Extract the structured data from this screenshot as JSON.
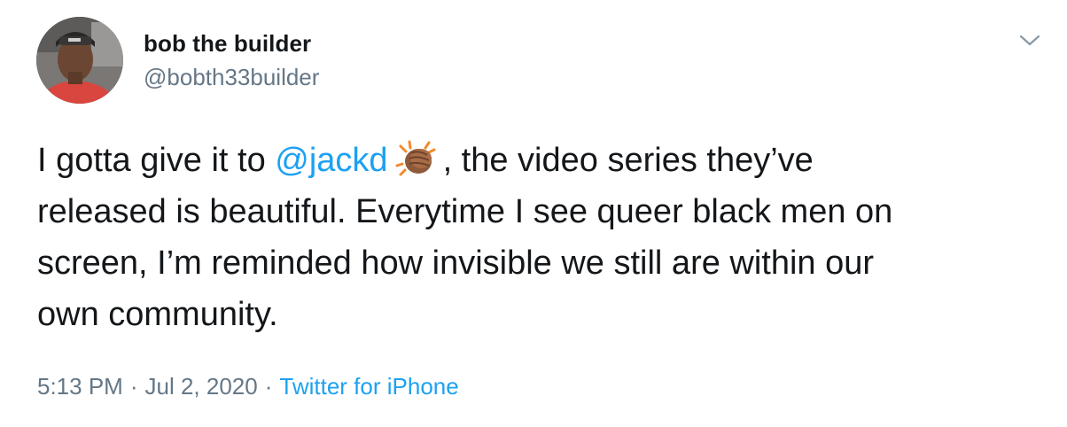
{
  "user": {
    "name": "bob the builder",
    "handle": "@bobth33builder"
  },
  "tweet": {
    "line1_before": "I gotta give it to ",
    "mention": "@jackd",
    "emoji_icon": "clapping-hands-icon",
    "line1_after": ", the video series they’ve",
    "line2": "released is beautiful. Everytime I see queer black men on",
    "line3": "screen, I’m reminded how invisible we still are within our",
    "line4": "own community."
  },
  "meta": {
    "time": "5:13 PM",
    "date": "Jul 2, 2020",
    "separator": "·",
    "source": "Twitter for iPhone"
  },
  "colors": {
    "link": "#1da1f2",
    "secondary": "#657786",
    "text": "#14171a"
  }
}
